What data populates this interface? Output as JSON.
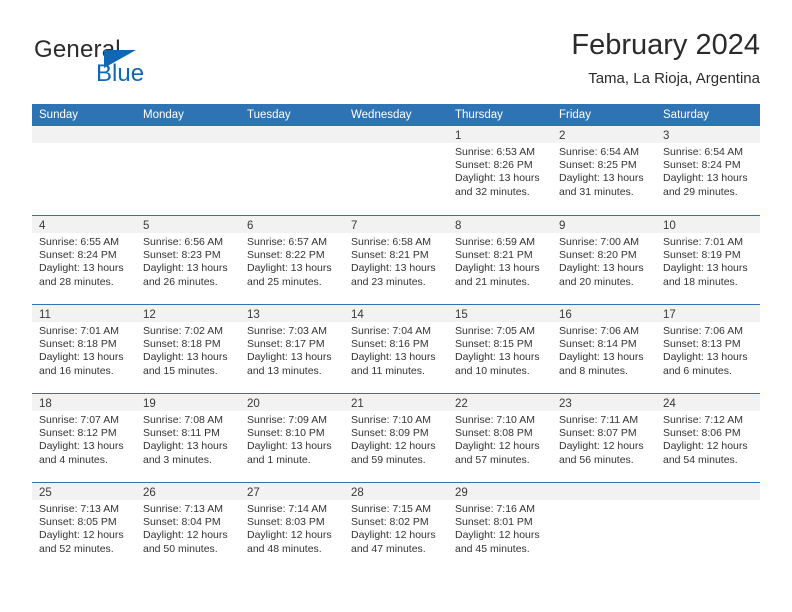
{
  "brand": {
    "line1": "General",
    "line2": "Blue",
    "triangle_icon": "brand-triangle-icon",
    "blue": "#1267b2"
  },
  "header": {
    "title": "February 2024",
    "subtitle": "Tama, La Rioja, Argentina"
  },
  "colors": {
    "header_blue": "#2e74b5",
    "daynum_band": "#f2f2f2",
    "text": "#333333"
  },
  "calendar": {
    "weekdays": [
      "Sunday",
      "Monday",
      "Tuesday",
      "Wednesday",
      "Thursday",
      "Friday",
      "Saturday"
    ],
    "weeks": [
      [
        {
          "day": "",
          "lines": []
        },
        {
          "day": "",
          "lines": []
        },
        {
          "day": "",
          "lines": []
        },
        {
          "day": "",
          "lines": []
        },
        {
          "day": "1",
          "lines": [
            "Sunrise: 6:53 AM",
            "Sunset: 8:26 PM",
            "Daylight: 13 hours",
            "and 32 minutes."
          ]
        },
        {
          "day": "2",
          "lines": [
            "Sunrise: 6:54 AM",
            "Sunset: 8:25 PM",
            "Daylight: 13 hours",
            "and 31 minutes."
          ]
        },
        {
          "day": "3",
          "lines": [
            "Sunrise: 6:54 AM",
            "Sunset: 8:24 PM",
            "Daylight: 13 hours",
            "and 29 minutes."
          ]
        }
      ],
      [
        {
          "day": "4",
          "lines": [
            "Sunrise: 6:55 AM",
            "Sunset: 8:24 PM",
            "Daylight: 13 hours",
            "and 28 minutes."
          ]
        },
        {
          "day": "5",
          "lines": [
            "Sunrise: 6:56 AM",
            "Sunset: 8:23 PM",
            "Daylight: 13 hours",
            "and 26 minutes."
          ]
        },
        {
          "day": "6",
          "lines": [
            "Sunrise: 6:57 AM",
            "Sunset: 8:22 PM",
            "Daylight: 13 hours",
            "and 25 minutes."
          ]
        },
        {
          "day": "7",
          "lines": [
            "Sunrise: 6:58 AM",
            "Sunset: 8:21 PM",
            "Daylight: 13 hours",
            "and 23 minutes."
          ]
        },
        {
          "day": "8",
          "lines": [
            "Sunrise: 6:59 AM",
            "Sunset: 8:21 PM",
            "Daylight: 13 hours",
            "and 21 minutes."
          ]
        },
        {
          "day": "9",
          "lines": [
            "Sunrise: 7:00 AM",
            "Sunset: 8:20 PM",
            "Daylight: 13 hours",
            "and 20 minutes."
          ]
        },
        {
          "day": "10",
          "lines": [
            "Sunrise: 7:01 AM",
            "Sunset: 8:19 PM",
            "Daylight: 13 hours",
            "and 18 minutes."
          ]
        }
      ],
      [
        {
          "day": "11",
          "lines": [
            "Sunrise: 7:01 AM",
            "Sunset: 8:18 PM",
            "Daylight: 13 hours",
            "and 16 minutes."
          ]
        },
        {
          "day": "12",
          "lines": [
            "Sunrise: 7:02 AM",
            "Sunset: 8:18 PM",
            "Daylight: 13 hours",
            "and 15 minutes."
          ]
        },
        {
          "day": "13",
          "lines": [
            "Sunrise: 7:03 AM",
            "Sunset: 8:17 PM",
            "Daylight: 13 hours",
            "and 13 minutes."
          ]
        },
        {
          "day": "14",
          "lines": [
            "Sunrise: 7:04 AM",
            "Sunset: 8:16 PM",
            "Daylight: 13 hours",
            "and 11 minutes."
          ]
        },
        {
          "day": "15",
          "lines": [
            "Sunrise: 7:05 AM",
            "Sunset: 8:15 PM",
            "Daylight: 13 hours",
            "and 10 minutes."
          ]
        },
        {
          "day": "16",
          "lines": [
            "Sunrise: 7:06 AM",
            "Sunset: 8:14 PM",
            "Daylight: 13 hours",
            "and 8 minutes."
          ]
        },
        {
          "day": "17",
          "lines": [
            "Sunrise: 7:06 AM",
            "Sunset: 8:13 PM",
            "Daylight: 13 hours",
            "and 6 minutes."
          ]
        }
      ],
      [
        {
          "day": "18",
          "lines": [
            "Sunrise: 7:07 AM",
            "Sunset: 8:12 PM",
            "Daylight: 13 hours",
            "and 4 minutes."
          ]
        },
        {
          "day": "19",
          "lines": [
            "Sunrise: 7:08 AM",
            "Sunset: 8:11 PM",
            "Daylight: 13 hours",
            "and 3 minutes."
          ]
        },
        {
          "day": "20",
          "lines": [
            "Sunrise: 7:09 AM",
            "Sunset: 8:10 PM",
            "Daylight: 13 hours",
            "and 1 minute."
          ]
        },
        {
          "day": "21",
          "lines": [
            "Sunrise: 7:10 AM",
            "Sunset: 8:09 PM",
            "Daylight: 12 hours",
            "and 59 minutes."
          ]
        },
        {
          "day": "22",
          "lines": [
            "Sunrise: 7:10 AM",
            "Sunset: 8:08 PM",
            "Daylight: 12 hours",
            "and 57 minutes."
          ]
        },
        {
          "day": "23",
          "lines": [
            "Sunrise: 7:11 AM",
            "Sunset: 8:07 PM",
            "Daylight: 12 hours",
            "and 56 minutes."
          ]
        },
        {
          "day": "24",
          "lines": [
            "Sunrise: 7:12 AM",
            "Sunset: 8:06 PM",
            "Daylight: 12 hours",
            "and 54 minutes."
          ]
        }
      ],
      [
        {
          "day": "25",
          "lines": [
            "Sunrise: 7:13 AM",
            "Sunset: 8:05 PM",
            "Daylight: 12 hours",
            "and 52 minutes."
          ]
        },
        {
          "day": "26",
          "lines": [
            "Sunrise: 7:13 AM",
            "Sunset: 8:04 PM",
            "Daylight: 12 hours",
            "and 50 minutes."
          ]
        },
        {
          "day": "27",
          "lines": [
            "Sunrise: 7:14 AM",
            "Sunset: 8:03 PM",
            "Daylight: 12 hours",
            "and 48 minutes."
          ]
        },
        {
          "day": "28",
          "lines": [
            "Sunrise: 7:15 AM",
            "Sunset: 8:02 PM",
            "Daylight: 12 hours",
            "and 47 minutes."
          ]
        },
        {
          "day": "29",
          "lines": [
            "Sunrise: 7:16 AM",
            "Sunset: 8:01 PM",
            "Daylight: 12 hours",
            "and 45 minutes."
          ]
        },
        {
          "day": "",
          "lines": []
        },
        {
          "day": "",
          "lines": []
        }
      ]
    ]
  }
}
